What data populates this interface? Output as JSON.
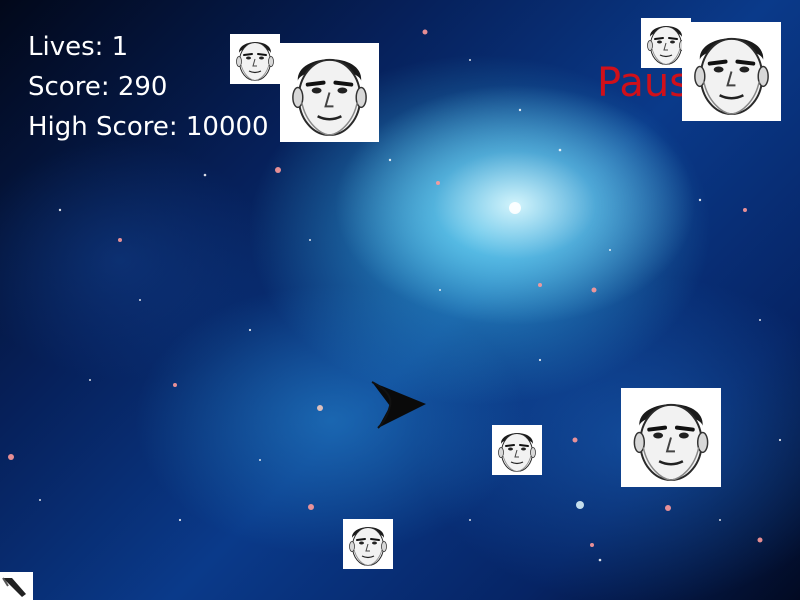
{
  "hud": {
    "lives_text": "Lives: 1",
    "score_text": "Score: 290",
    "high_score_text": "High Score: 10000",
    "pause_text": "Pause"
  },
  "colors": {
    "hud_text": "#ffffff",
    "pause_text": "#d0101a"
  },
  "icons": {
    "enemy": "face-icon",
    "player": "arrow-ship-icon",
    "corner": "cursor-icon"
  }
}
